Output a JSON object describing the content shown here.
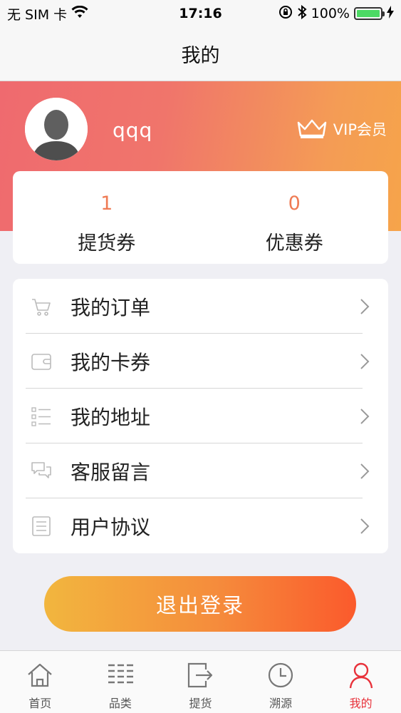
{
  "status_bar": {
    "carrier": "无 SIM 卡",
    "time": "17:16",
    "battery_percent": "100%"
  },
  "nav": {
    "title": "我的"
  },
  "profile": {
    "username": "qqq",
    "vip_label": "VIP会员"
  },
  "coupons": [
    {
      "count": "1",
      "label": "提货券"
    },
    {
      "count": "0",
      "label": "优惠券"
    }
  ],
  "menu": [
    {
      "label": "我的订单",
      "icon": "cart-icon"
    },
    {
      "label": "我的卡券",
      "icon": "wallet-icon"
    },
    {
      "label": "我的地址",
      "icon": "list-icon"
    },
    {
      "label": "客服留言",
      "icon": "chat-icon"
    },
    {
      "label": "用户协议",
      "icon": "document-icon"
    }
  ],
  "logout_label": "退出登录",
  "tabs": [
    {
      "label": "首页",
      "icon": "home-icon",
      "active": false
    },
    {
      "label": "品类",
      "icon": "category-icon",
      "active": false
    },
    {
      "label": "提货",
      "icon": "pickup-icon",
      "active": false
    },
    {
      "label": "溯源",
      "icon": "clock-icon",
      "active": false
    },
    {
      "label": "我的",
      "icon": "user-icon",
      "active": true
    }
  ],
  "colors": {
    "accent": "#e8313a",
    "coupon_count": "#ef7b54",
    "header_gradient_start": "#ef6a6f",
    "header_gradient_end": "#f6a44a"
  }
}
